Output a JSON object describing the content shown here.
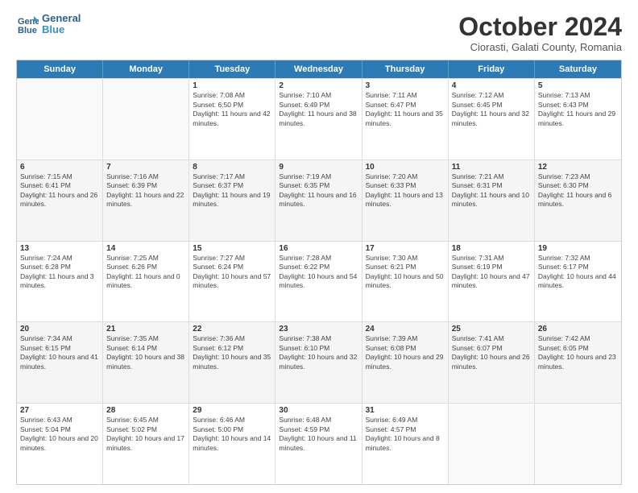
{
  "logo": {
    "line1": "General",
    "line2": "Blue"
  },
  "header": {
    "month": "October 2024",
    "location": "Ciorasti, Galati County, Romania"
  },
  "weekdays": [
    "Sunday",
    "Monday",
    "Tuesday",
    "Wednesday",
    "Thursday",
    "Friday",
    "Saturday"
  ],
  "rows": [
    [
      {
        "day": "",
        "info": "",
        "empty": true
      },
      {
        "day": "",
        "info": "",
        "empty": true
      },
      {
        "day": "1",
        "info": "Sunrise: 7:08 AM\nSunset: 6:50 PM\nDaylight: 11 hours and 42 minutes."
      },
      {
        "day": "2",
        "info": "Sunrise: 7:10 AM\nSunset: 6:49 PM\nDaylight: 11 hours and 38 minutes."
      },
      {
        "day": "3",
        "info": "Sunrise: 7:11 AM\nSunset: 6:47 PM\nDaylight: 11 hours and 35 minutes."
      },
      {
        "day": "4",
        "info": "Sunrise: 7:12 AM\nSunset: 6:45 PM\nDaylight: 11 hours and 32 minutes."
      },
      {
        "day": "5",
        "info": "Sunrise: 7:13 AM\nSunset: 6:43 PM\nDaylight: 11 hours and 29 minutes."
      }
    ],
    [
      {
        "day": "6",
        "info": "Sunrise: 7:15 AM\nSunset: 6:41 PM\nDaylight: 11 hours and 26 minutes."
      },
      {
        "day": "7",
        "info": "Sunrise: 7:16 AM\nSunset: 6:39 PM\nDaylight: 11 hours and 22 minutes."
      },
      {
        "day": "8",
        "info": "Sunrise: 7:17 AM\nSunset: 6:37 PM\nDaylight: 11 hours and 19 minutes."
      },
      {
        "day": "9",
        "info": "Sunrise: 7:19 AM\nSunset: 6:35 PM\nDaylight: 11 hours and 16 minutes."
      },
      {
        "day": "10",
        "info": "Sunrise: 7:20 AM\nSunset: 6:33 PM\nDaylight: 11 hours and 13 minutes."
      },
      {
        "day": "11",
        "info": "Sunrise: 7:21 AM\nSunset: 6:31 PM\nDaylight: 11 hours and 10 minutes."
      },
      {
        "day": "12",
        "info": "Sunrise: 7:23 AM\nSunset: 6:30 PM\nDaylight: 11 hours and 6 minutes."
      }
    ],
    [
      {
        "day": "13",
        "info": "Sunrise: 7:24 AM\nSunset: 6:28 PM\nDaylight: 11 hours and 3 minutes."
      },
      {
        "day": "14",
        "info": "Sunrise: 7:25 AM\nSunset: 6:26 PM\nDaylight: 11 hours and 0 minutes."
      },
      {
        "day": "15",
        "info": "Sunrise: 7:27 AM\nSunset: 6:24 PM\nDaylight: 10 hours and 57 minutes."
      },
      {
        "day": "16",
        "info": "Sunrise: 7:28 AM\nSunset: 6:22 PM\nDaylight: 10 hours and 54 minutes."
      },
      {
        "day": "17",
        "info": "Sunrise: 7:30 AM\nSunset: 6:21 PM\nDaylight: 10 hours and 50 minutes."
      },
      {
        "day": "18",
        "info": "Sunrise: 7:31 AM\nSunset: 6:19 PM\nDaylight: 10 hours and 47 minutes."
      },
      {
        "day": "19",
        "info": "Sunrise: 7:32 AM\nSunset: 6:17 PM\nDaylight: 10 hours and 44 minutes."
      }
    ],
    [
      {
        "day": "20",
        "info": "Sunrise: 7:34 AM\nSunset: 6:15 PM\nDaylight: 10 hours and 41 minutes."
      },
      {
        "day": "21",
        "info": "Sunrise: 7:35 AM\nSunset: 6:14 PM\nDaylight: 10 hours and 38 minutes."
      },
      {
        "day": "22",
        "info": "Sunrise: 7:36 AM\nSunset: 6:12 PM\nDaylight: 10 hours and 35 minutes."
      },
      {
        "day": "23",
        "info": "Sunrise: 7:38 AM\nSunset: 6:10 PM\nDaylight: 10 hours and 32 minutes."
      },
      {
        "day": "24",
        "info": "Sunrise: 7:39 AM\nSunset: 6:08 PM\nDaylight: 10 hours and 29 minutes."
      },
      {
        "day": "25",
        "info": "Sunrise: 7:41 AM\nSunset: 6:07 PM\nDaylight: 10 hours and 26 minutes."
      },
      {
        "day": "26",
        "info": "Sunrise: 7:42 AM\nSunset: 6:05 PM\nDaylight: 10 hours and 23 minutes."
      }
    ],
    [
      {
        "day": "27",
        "info": "Sunrise: 6:43 AM\nSunset: 5:04 PM\nDaylight: 10 hours and 20 minutes."
      },
      {
        "day": "28",
        "info": "Sunrise: 6:45 AM\nSunset: 5:02 PM\nDaylight: 10 hours and 17 minutes."
      },
      {
        "day": "29",
        "info": "Sunrise: 6:46 AM\nSunset: 5:00 PM\nDaylight: 10 hours and 14 minutes."
      },
      {
        "day": "30",
        "info": "Sunrise: 6:48 AM\nSunset: 4:59 PM\nDaylight: 10 hours and 11 minutes."
      },
      {
        "day": "31",
        "info": "Sunrise: 6:49 AM\nSunset: 4:57 PM\nDaylight: 10 hours and 8 minutes."
      },
      {
        "day": "",
        "info": "",
        "empty": true
      },
      {
        "day": "",
        "info": "",
        "empty": true
      }
    ]
  ]
}
